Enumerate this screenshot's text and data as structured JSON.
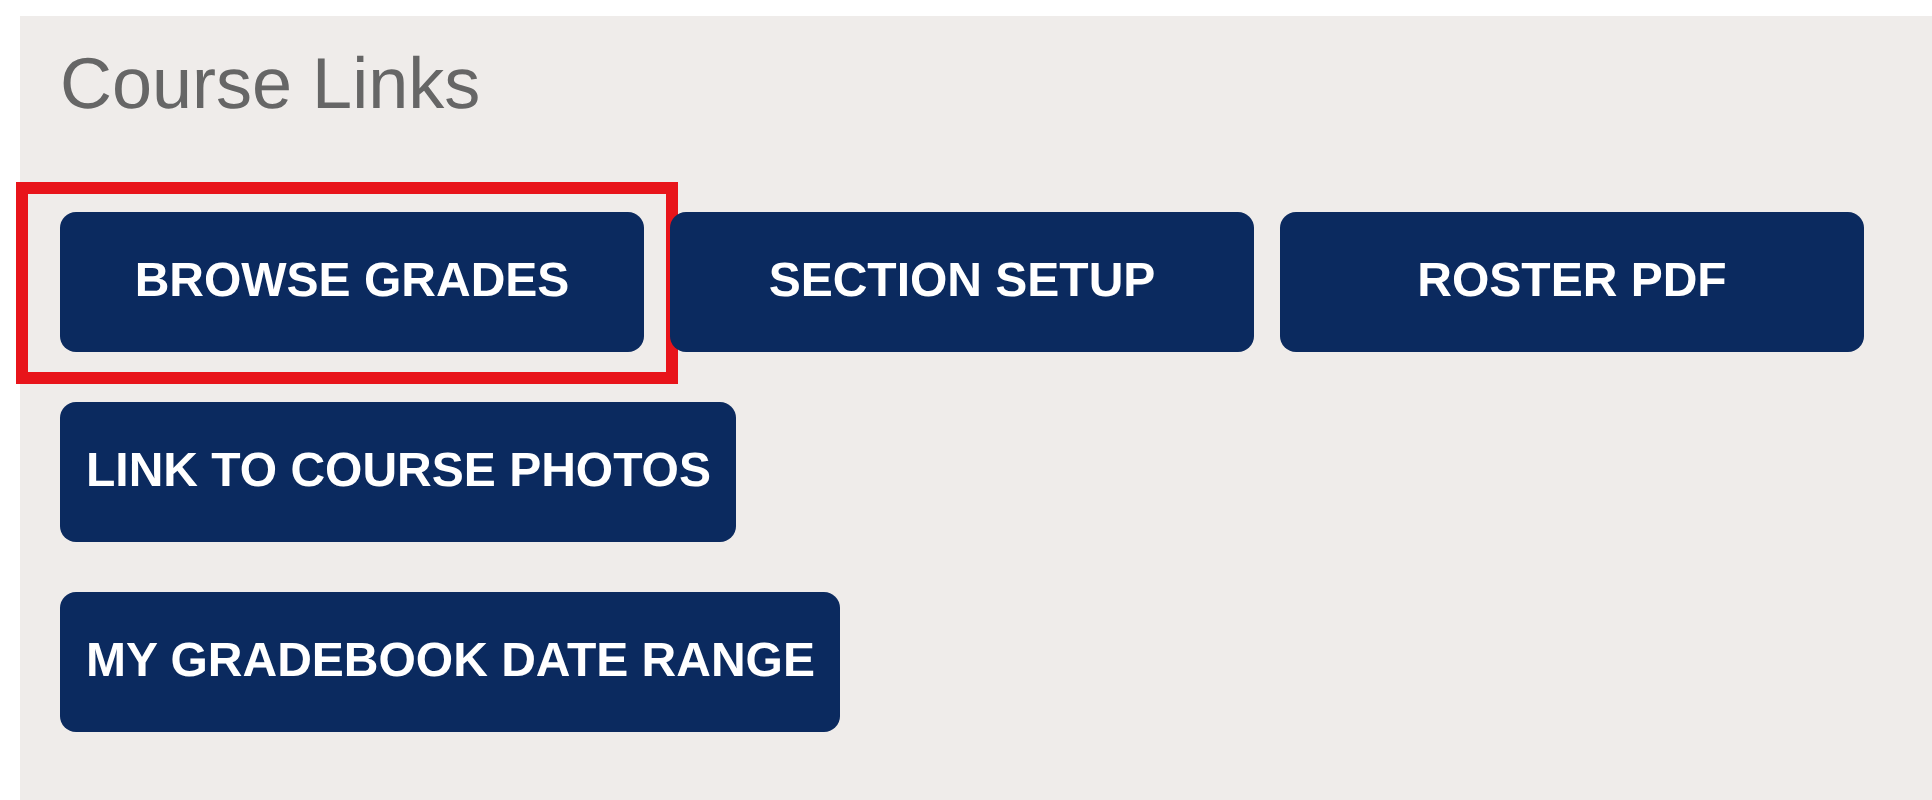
{
  "panel": {
    "title": "Course Links"
  },
  "button_rows": [
    {
      "buttons": [
        {
          "label": "BROWSE GRADES",
          "highlighted": true
        },
        {
          "label": "SECTION SETUP",
          "highlighted": false
        },
        {
          "label": "ROSTER PDF",
          "highlighted": false
        }
      ]
    },
    {
      "buttons": [
        {
          "label": "LINK TO COURSE PHOTOS",
          "highlighted": false
        }
      ]
    },
    {
      "buttons": [
        {
          "label": "MY GRADEBOOK DATE RANGE",
          "highlighted": false
        }
      ]
    }
  ]
}
